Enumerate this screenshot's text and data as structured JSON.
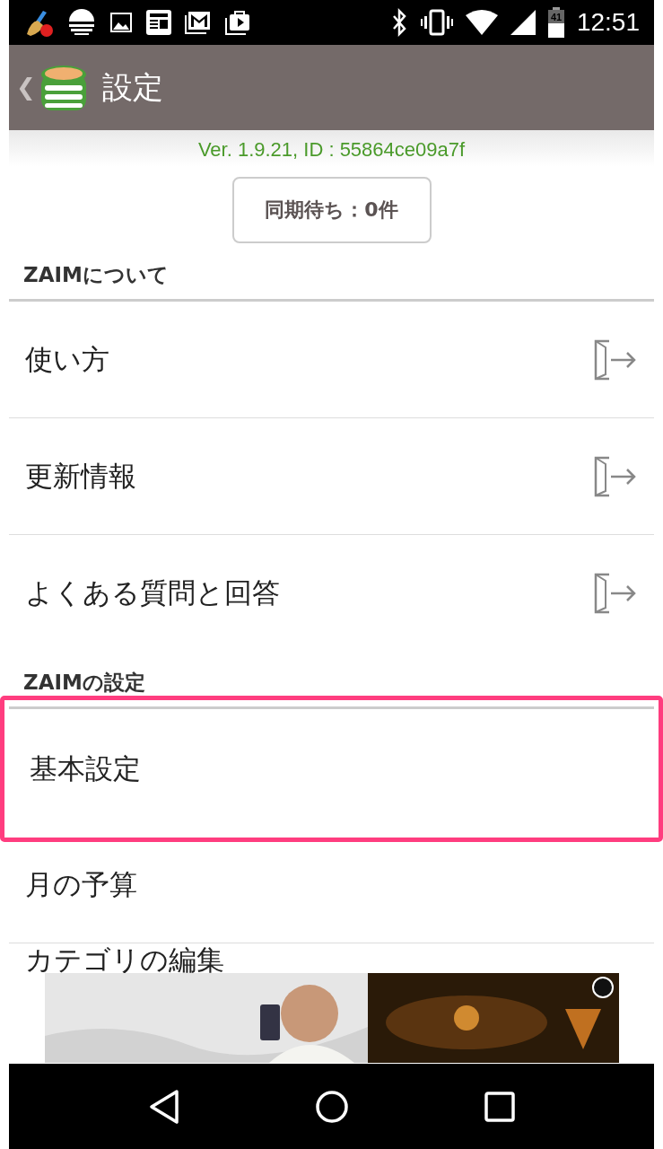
{
  "status_bar": {
    "time": "12:51",
    "battery": "41"
  },
  "header": {
    "back": "❮",
    "title": "設定"
  },
  "version": "Ver. 1.9.21, ID : 55864ce09a7f",
  "sync_button": "同期待ち：0件",
  "sections": [
    {
      "title": "ZAIMについて",
      "items": [
        {
          "label": "使い方",
          "kind": "link",
          "highlighted": false
        },
        {
          "label": "更新情報",
          "kind": "link",
          "highlighted": false
        },
        {
          "label": "よくある質問と回答",
          "kind": "link",
          "highlighted": false
        }
      ]
    },
    {
      "title": "ZAIMの設定",
      "items": [
        {
          "label": "基本設定",
          "kind": "plain",
          "highlighted": true
        },
        {
          "label": "月の予算",
          "kind": "plain",
          "highlighted": false
        },
        {
          "label": "カテゴリの編集",
          "kind": "plain",
          "highlighted": false
        }
      ]
    }
  ]
}
